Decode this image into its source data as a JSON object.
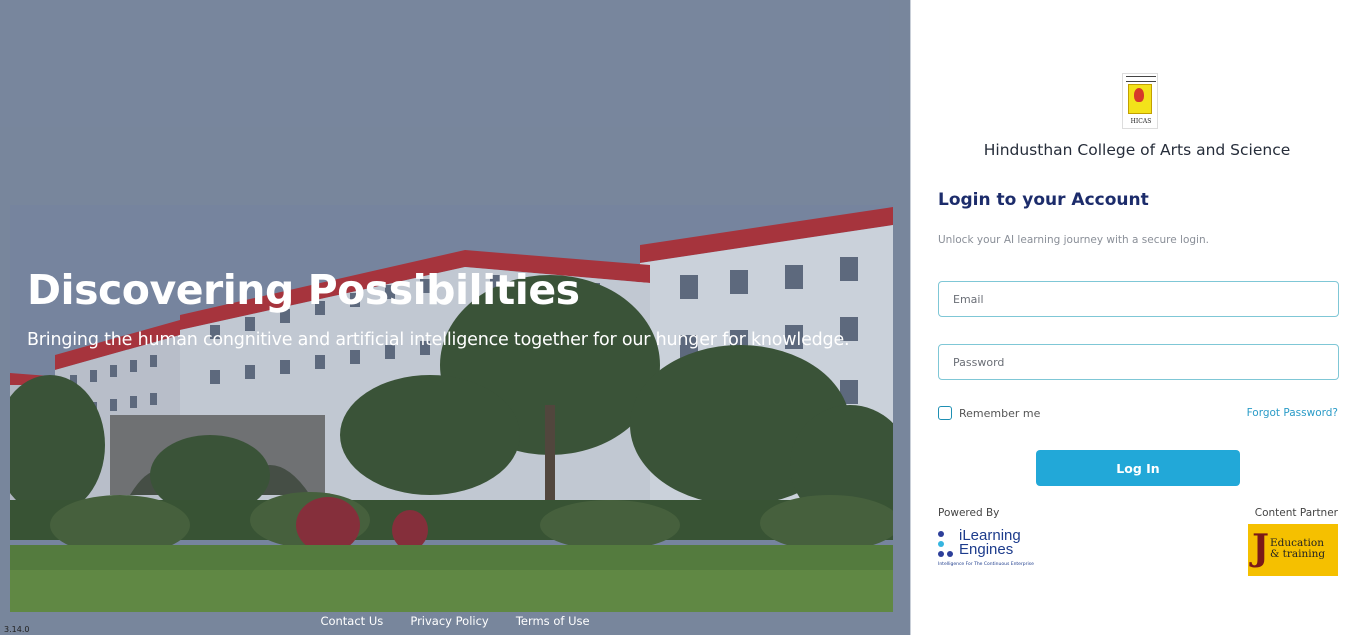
{
  "hero": {
    "title": "Discovering Possibilities",
    "subtitle": "Bringing the human congnitive and artificial intelligence together for our hunger for knowledge.",
    "footer_links": [
      "Contact Us",
      "Privacy Policy",
      "Terms of Use"
    ],
    "version": "3.14.0"
  },
  "college": {
    "name": "Hindusthan College of Arts and Science",
    "logo_text": "HICAS"
  },
  "login": {
    "title": "Login to your Account",
    "subtitle": "Unlock your AI learning journey with a secure login.",
    "email_placeholder": "Email",
    "password_placeholder": "Password",
    "remember_label": "Remember me",
    "forgot_label": "Forgot Password?",
    "button_label": "Log In"
  },
  "partners": {
    "powered_by_label": "Powered By",
    "powered_by_name_line1": "iLearning",
    "powered_by_name_line2": "Engines",
    "powered_by_tagline": "Intelligence For The Continuous Enterprise",
    "content_partner_label": "Content Partner",
    "content_partner_name_line1": "Education",
    "content_partner_name_line2": "& training"
  },
  "colors": {
    "accent": "#22a8d8",
    "title": "#1c2c6b",
    "field_border": "#7fc7d6",
    "link": "#2a9bc7"
  },
  "icons": [
    "college-logo-icon",
    "checkbox-icon",
    "ilearning-engines-logo",
    "education-training-logo"
  ]
}
